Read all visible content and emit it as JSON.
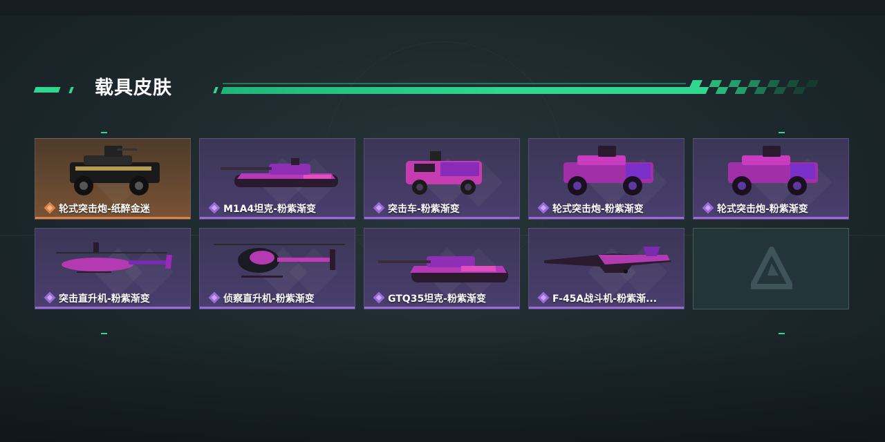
{
  "section": {
    "title": "载具皮肤"
  },
  "colors": {
    "accent": "#2fd78f",
    "rare_purple": "#9a6bd8",
    "legendary_gold": "#d9854a"
  },
  "skins": [
    {
      "name": "轮式突击炮-纸醉金迷",
      "rarity": "gold",
      "vehicle": "wheeled-assault-gun"
    },
    {
      "name": "M1A4坦克-粉紫渐变",
      "rarity": "purple",
      "vehicle": "tank"
    },
    {
      "name": "突击车-粉紫渐变",
      "rarity": "purple",
      "vehicle": "assault-vehicle"
    },
    {
      "name": "轮式突击炮-粉紫渐变",
      "rarity": "purple",
      "vehicle": "wheeled-assault-gun"
    },
    {
      "name": "轮式突击炮-粉紫渐变",
      "rarity": "purple",
      "vehicle": "wheeled-assault-gun"
    },
    {
      "name": "突击直升机-粉紫渐变",
      "rarity": "purple",
      "vehicle": "attack-helicopter"
    },
    {
      "name": "侦察直升机-粉紫渐变",
      "rarity": "purple",
      "vehicle": "scout-helicopter"
    },
    {
      "name": "GTQ35坦克-粉紫渐变",
      "rarity": "purple",
      "vehicle": "tank"
    },
    {
      "name": "F-45A战斗机-粉紫渐...",
      "rarity": "purple",
      "vehicle": "fighter-jet"
    }
  ],
  "empty_slot": {
    "icon": "game-logo-icon"
  }
}
